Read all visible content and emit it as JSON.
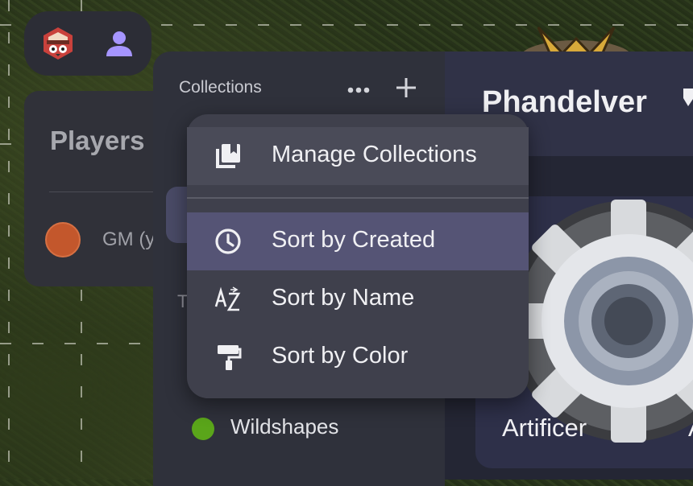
{
  "toolbar": {
    "logo_icon": "owlbear-logo-icon",
    "user_icon": "person-icon"
  },
  "players": {
    "title": "Players",
    "items": [
      {
        "label": "GM (y",
        "color": "#c3572c"
      }
    ]
  },
  "collections": {
    "title": "Collections",
    "more_icon": "more-horizontal-icon",
    "add_icon": "plus-icon",
    "partial_label": "T",
    "items": [
      {
        "label": "Wildshapes",
        "color": "#5aa51a"
      }
    ]
  },
  "main": {
    "title": "Phandelver",
    "card": {
      "label": "Artificer",
      "partial_label": "A"
    }
  },
  "menu": {
    "items": [
      {
        "label": "Manage Collections",
        "icon": "collections-icon"
      },
      {
        "label": "Sort by Created",
        "icon": "clock-icon",
        "active": true
      },
      {
        "label": "Sort by Name",
        "icon": "sort-az-icon"
      },
      {
        "label": "Sort by Color",
        "icon": "paint-roller-icon"
      }
    ]
  },
  "colors": {
    "menu_bg": "#3f404c",
    "menu_active": "#555475",
    "panel_bg": "#2f313b",
    "accent_selected": "#4a4b67",
    "user_icon": "#a695ff"
  }
}
